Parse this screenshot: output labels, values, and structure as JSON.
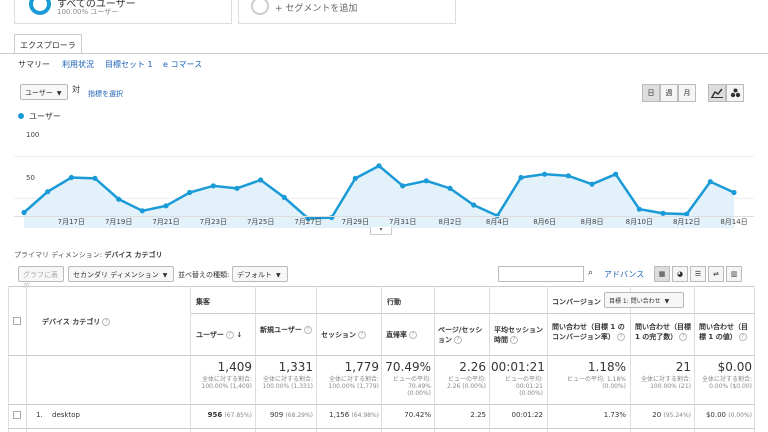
{
  "segments": {
    "all_users_title": "すべてのユーザー",
    "all_users_sub": "100.00% ユーザー",
    "add_segment": "+ セグメントを追加"
  },
  "explorer_tab": "エクスプローラ",
  "subnav": [
    "サマリー",
    "利用状況",
    "目標セット 1",
    "e コマース"
  ],
  "metric_select": "ユーザー",
  "vs_label": "対",
  "select_metric_link": "指標を選択",
  "period_buttons": [
    "日",
    "週",
    "月"
  ],
  "legend_label": "ユーザー",
  "colors": {
    "accent": "#1a9ad6",
    "area": "#e3f1fa"
  },
  "chart_data": {
    "type": "area",
    "series": [
      {
        "name": "ユーザー",
        "values": [
          33,
          58,
          75,
          74,
          49,
          35,
          41,
          57,
          65,
          62,
          72,
          51,
          26,
          27,
          74,
          89,
          65,
          71,
          62,
          42,
          29,
          75,
          79,
          77,
          67,
          79,
          37,
          32,
          31,
          70,
          57
        ]
      }
    ],
    "ylim": [
      0,
      120
    ],
    "y_ticks": [
      "100",
      "50"
    ],
    "x_ticks": [
      "7月17日",
      "7月19日",
      "7月21日",
      "7月23日",
      "7月25日",
      "7月27日",
      "7月29日",
      "7月31日",
      "8月2日",
      "8月4日",
      "8月6日",
      "8月8日",
      "8月10日",
      "8月12日",
      "8月14日"
    ]
  },
  "primary_dimension_label": "プライマリ ディメンション:",
  "primary_dimension_value": "デバイス カテゴリ",
  "toolbar": {
    "plot_rows": "グラフに表示",
    "secondary_dim": "セカンダリ ディメンション",
    "sort_type_label": "並べ替えの種類:",
    "sort_type_value": "デフォルト",
    "advanced": "アドバンス"
  },
  "table": {
    "dim_header": "デバイス カテゴリ",
    "group_acquisition": "集客",
    "group_behavior": "行動",
    "group_conversion": "コンバージョン",
    "goal_select": "目標 1: 問い合わせ",
    "columns": [
      "ユーザー",
      "新規ユーザー",
      "セッション",
      "直帰率",
      "ページ/セッション",
      "平均セッション時間",
      "問い合わせ（目標 1 のコンバージョン率）",
      "問い合わせ（目標 1 の完了数）",
      "問い合わせ（目標 1 の値）"
    ],
    "totals": [
      "1,409",
      "1,331",
      "1,779",
      "70.49%",
      "2.26",
      "00:01:21",
      "1.18%",
      "21",
      "$0.00"
    ],
    "totals_sub": [
      "全体に対する割合: 100.00% (1,409)",
      "全体に対する割合: 100.00% (1,331)",
      "全体に対する割合: 100.00% (1,779)",
      "ビューの平均: 70.49% (0.00%)",
      "ビューの平均: 2.26 (0.00%)",
      "ビューの平均: 00:01:21 (0.00%)",
      "ビューの平均: 1.18% (0.00%)",
      "全体に対する割合: 100.00% (21)",
      "全体に対する割合: 0.00% ($0.00)"
    ],
    "rows": [
      {
        "num": "1.",
        "dim": "desktop",
        "users": "956",
        "users_pct": "(67.85%)",
        "new_users": "909",
        "new_users_pct": "(68.29%)",
        "sessions": "1,156",
        "sessions_pct": "(64.98%)",
        "bounce": "70.42%",
        "pps": "2.25",
        "avg_time": "00:01:22",
        "conv_rate": "1.73%",
        "completions": "20",
        "completions_pct": "(95.24%)",
        "value": "$0.00",
        "value_pct": "(0.00%)"
      }
    ]
  }
}
